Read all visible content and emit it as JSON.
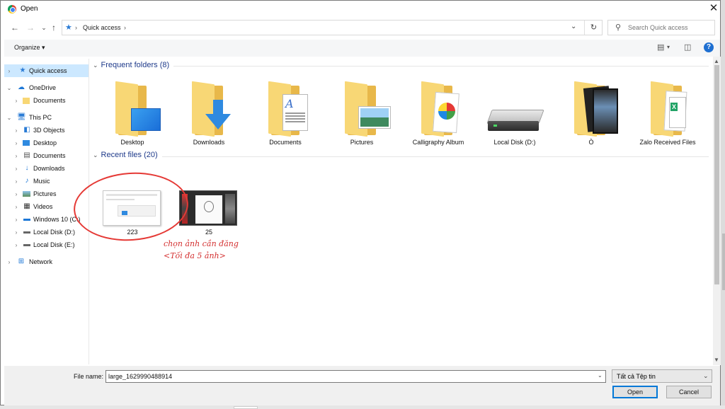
{
  "window": {
    "title": "Open",
    "close_symbol": "✕"
  },
  "nav": {
    "back": "←",
    "forward": "→",
    "recent": "⌄",
    "up": "↑",
    "breadcrumb_sep": "›",
    "breadcrumb": "Quick access",
    "refresh": "↻",
    "search_placeholder": "Search Quick access"
  },
  "toolbar": {
    "organize": "Organize ▾",
    "help": "?"
  },
  "sidebar": {
    "items": [
      {
        "label": "Quick access",
        "icon": "star-icon"
      },
      {
        "label": "OneDrive",
        "icon": "cloud-icon"
      },
      {
        "label": "Documents",
        "icon": "folder-icon"
      },
      {
        "label": "This PC",
        "icon": "monitor-icon"
      },
      {
        "label": "3D Objects",
        "icon": "cube-icon"
      },
      {
        "label": "Desktop",
        "icon": "desktop-icon"
      },
      {
        "label": "Documents",
        "icon": "document-icon"
      },
      {
        "label": "Downloads",
        "icon": "download-icon"
      },
      {
        "label": "Music",
        "icon": "music-icon"
      },
      {
        "label": "Pictures",
        "icon": "picture-icon"
      },
      {
        "label": "Videos",
        "icon": "video-icon"
      },
      {
        "label": "Windows 10 (C:)",
        "icon": "drive-icon"
      },
      {
        "label": "Local Disk (D:)",
        "icon": "drive-icon"
      },
      {
        "label": "Local Disk (E:)",
        "icon": "drive-icon"
      },
      {
        "label": "Network",
        "icon": "network-icon"
      }
    ]
  },
  "frequent": {
    "header": "Frequent folders (8)",
    "items": [
      {
        "label": "Desktop",
        "icon": "desktop-folder-icon"
      },
      {
        "label": "Downloads",
        "icon": "downloads-folder-icon"
      },
      {
        "label": "Documents",
        "icon": "documents-folder-icon"
      },
      {
        "label": "Pictures",
        "icon": "pictures-folder-icon"
      },
      {
        "label": "Calligraphy Album",
        "icon": "album-folder-icon"
      },
      {
        "label": "Local Disk (D:)",
        "icon": "hard-drive-icon"
      },
      {
        "label": "Ò",
        "icon": "photo-folder-icon"
      },
      {
        "label": "Zalo Received Files",
        "icon": "spreadsheet-folder-icon"
      }
    ]
  },
  "recent": {
    "header": "Recent files (20)",
    "items": [
      {
        "label": "223",
        "icon": "screenshot-thumbnail"
      },
      {
        "label": "25",
        "icon": "image-thumbnail"
      }
    ]
  },
  "annotation": {
    "line1": "chọn ảnh cần đăng",
    "line2": "<Tối đa 5 ảnh>",
    "color": "#e53935"
  },
  "footer": {
    "file_name_label": "File name:",
    "file_name_value": "large_1629990488914",
    "file_type": "Tất cả Tệp tin",
    "open": "Open",
    "cancel": "Cancel"
  },
  "colors": {
    "selection": "#cce8ff",
    "folder": "#f8d775",
    "accent": "#0078d7",
    "header_text": "#1e3a8a"
  }
}
